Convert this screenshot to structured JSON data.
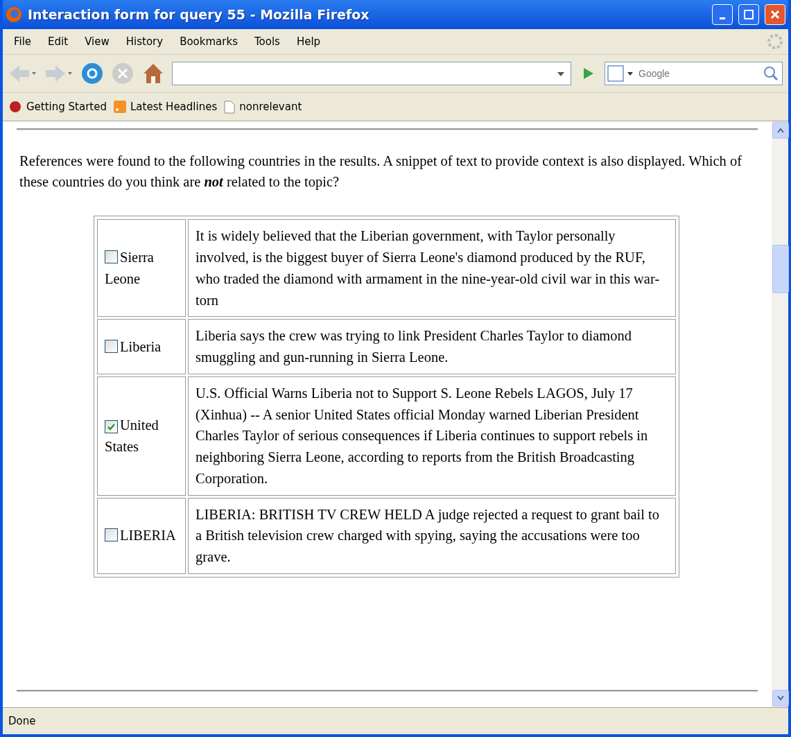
{
  "window": {
    "title": "Interaction form for query 55 - Mozilla Firefox"
  },
  "menu": [
    "File",
    "Edit",
    "View",
    "History",
    "Bookmarks",
    "Tools",
    "Help"
  ],
  "toolbar": {
    "search": {
      "placeholder": "Google"
    }
  },
  "bookmarks": [
    {
      "label": "Getting Started",
      "kind": "firefox"
    },
    {
      "label": "Latest Headlines",
      "kind": "feed"
    },
    {
      "label": "nonrelevant",
      "kind": "page"
    }
  ],
  "page": {
    "intro": "References were found to the following countries in the results. A snippet of text to provide context is also displayed. Which of these countries do you think are **not** related to the topic?",
    "rows": [
      {
        "country": "Sierra Leone",
        "checked": false,
        "snippet": "It is widely believed that the Liberian government, with Taylor personally involved, is the biggest buyer of Sierra Leone's diamond produced by the RUF, who traded the diamond with armament in the nine-year-old civil war in this war-torn"
      },
      {
        "country": "Liberia",
        "checked": false,
        "snippet": "Liberia says the crew was trying to link President Charles Taylor to diamond smuggling and gun-running in Sierra Leone."
      },
      {
        "country": "United States",
        "checked": true,
        "snippet": "U.S. Official Warns Liberia not to Support S. Leone Rebels LAGOS, July 17 (Xinhua) -- A senior United States official Monday warned Liberian President Charles Taylor of serious consequences if Liberia continues to support rebels in neighboring Sierra Leone, according to reports from the British Broadcasting Corporation."
      },
      {
        "country": "LIBERIA",
        "checked": false,
        "snippet": "LIBERIA: BRITISH TV CREW HELD A judge rejected a request to grant bail to a British television crew charged with spying, saying the accusations were too grave."
      }
    ]
  },
  "status_bar": "Done"
}
